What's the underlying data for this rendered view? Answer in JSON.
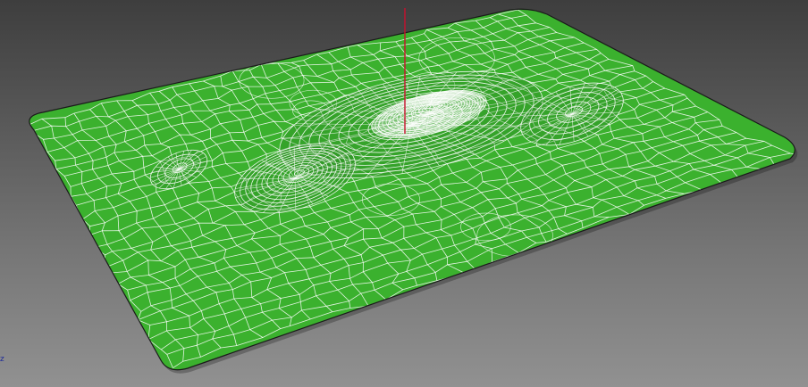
{
  "viewport": {
    "background_top": "#3e3e3e",
    "background_bottom": "#919191",
    "mesh_fill": "#3bb12e",
    "wire_color": "#ffffff",
    "outline_color": "#1a1a1a",
    "axis_color": "#c8102e",
    "axis_icon": "z-axis-gizmo-icon",
    "corner_text": "z"
  }
}
